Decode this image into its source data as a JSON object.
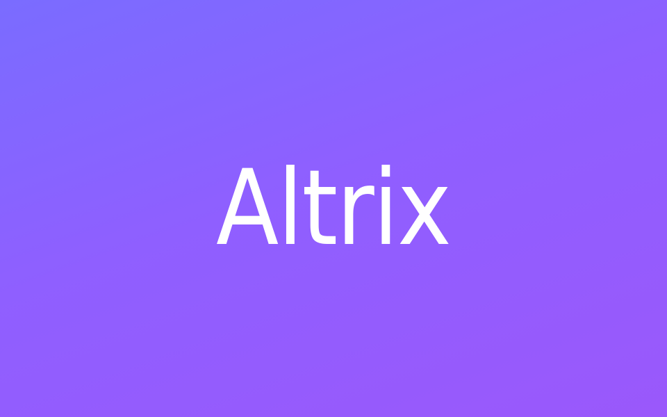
{
  "splash": {
    "logo_text": "Altrix",
    "colors": {
      "gradient_start": "#7a6cff",
      "gradient_mid": "#8f5fff",
      "gradient_end": "#9a58fb",
      "logo": "#ffffff"
    }
  }
}
